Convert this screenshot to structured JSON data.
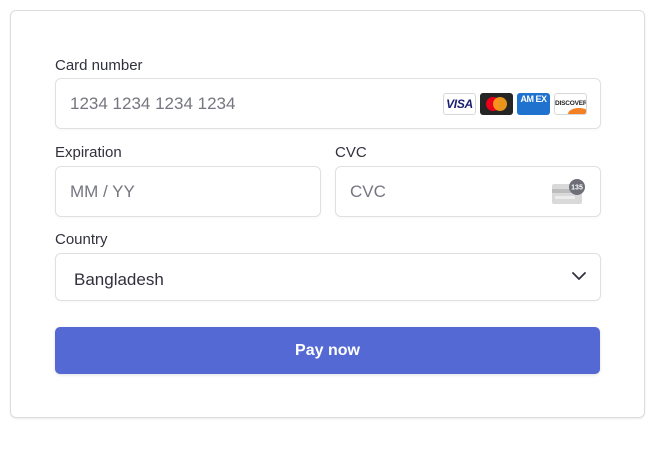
{
  "form": {
    "card_number": {
      "label": "Card number",
      "placeholder": "1234 1234 1234 1234",
      "value": "",
      "brands": {
        "visa": "VISA",
        "amex": "AM EX",
        "discover": "DISCOVER"
      }
    },
    "expiration": {
      "label": "Expiration",
      "placeholder": "MM / YY",
      "value": ""
    },
    "cvc": {
      "label": "CVC",
      "placeholder": "CVC",
      "value": "",
      "icon_text": "135"
    },
    "country": {
      "label": "Country",
      "selected": "Bangladesh"
    },
    "submit_label": "Pay now"
  },
  "colors": {
    "accent": "#5469d4",
    "label_text": "#30313d",
    "placeholder_text": "#757680",
    "border": "#e0e0e0"
  },
  "icons": {
    "brand_visa": "visa-logo-icon",
    "brand_mastercard": "mastercard-logo-icon",
    "brand_amex": "amex-logo-icon",
    "brand_discover": "discover-logo-icon",
    "cvc": "card-back-cvc-icon",
    "dropdown": "chevron-down-icon"
  }
}
